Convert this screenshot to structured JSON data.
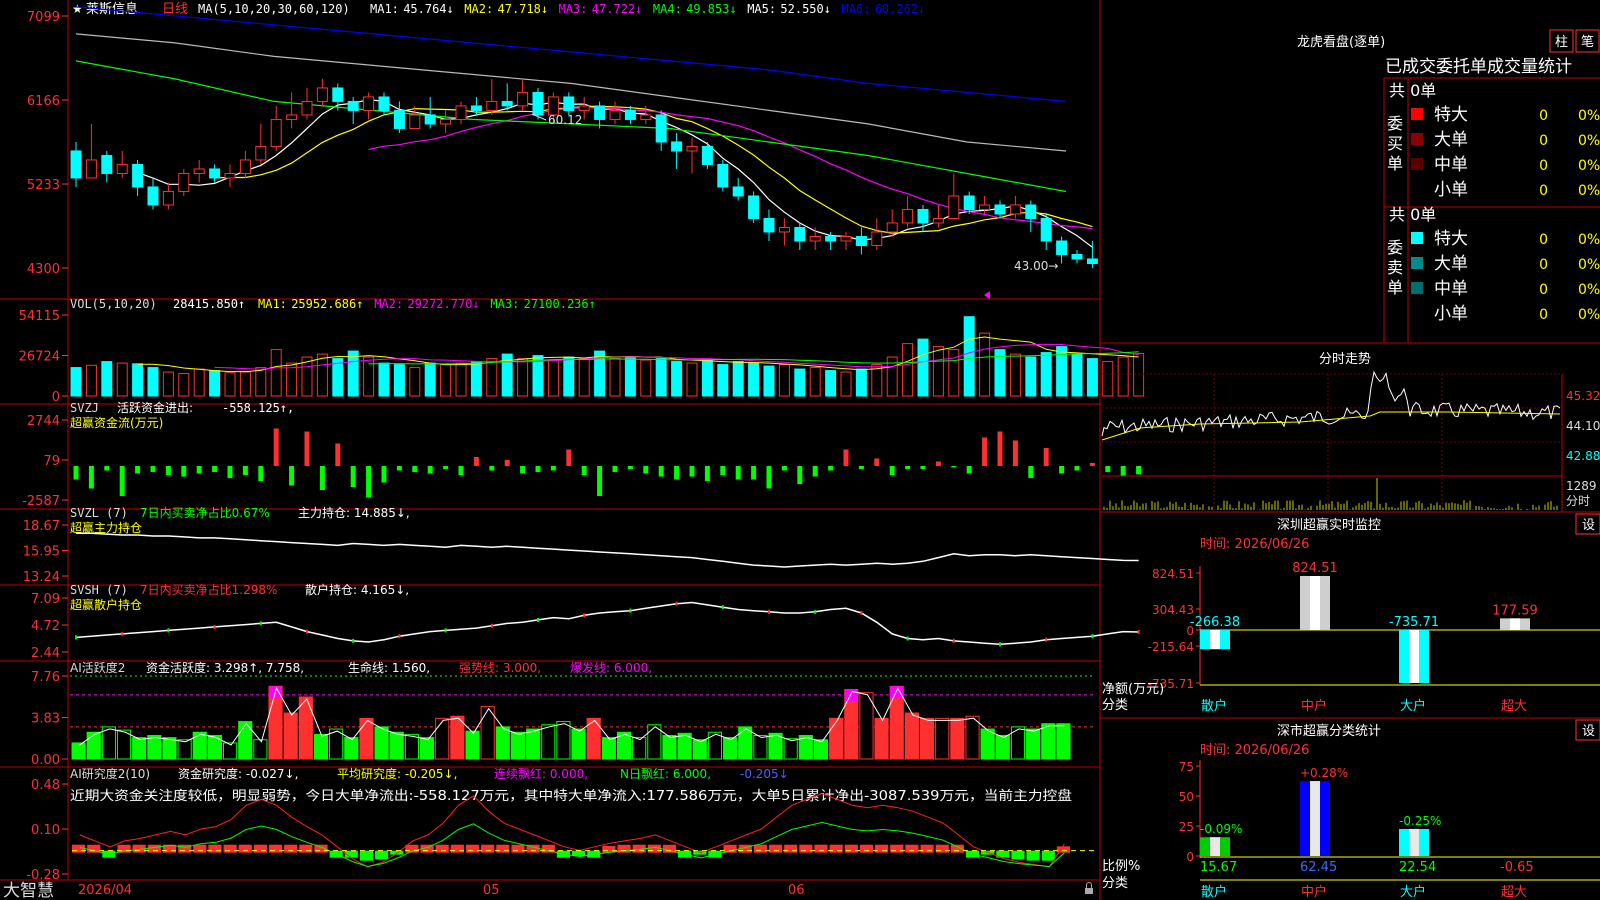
{
  "stock": {
    "name": "莱斯信息",
    "period": "日线",
    "star": "★",
    "ma_params": "MA(5,10,20,30,60,120)"
  },
  "ma_readouts": [
    {
      "label": "MA1:",
      "value": "45.764↓",
      "color": "#ffffff"
    },
    {
      "label": "MA2:",
      "value": "47.718↓",
      "color": "#ffff00"
    },
    {
      "label": "MA3:",
      "value": "47.722↓",
      "color": "#ff00ff"
    },
    {
      "label": "MA4:",
      "value": "49.853↓",
      "color": "#00ff00"
    },
    {
      "label": "MA5:",
      "value": "52.550↓",
      "color": "#ffffff"
    },
    {
      "label": "MA6:",
      "value": "60.262↓",
      "color": "#0000ff"
    }
  ],
  "price_axis": [
    "7099",
    "6166",
    "5233",
    "4300"
  ],
  "price_annotations": {
    "high": "60.12",
    "low": "43.00→"
  },
  "vol_panel": {
    "title": "VOL(5,10,20)",
    "value": "28415.850↑",
    "readouts": [
      {
        "label": "MA1:",
        "value": "25952.686↑",
        "color": "#ffff00"
      },
      {
        "label": "MA2:",
        "value": "29272.770↓",
        "color": "#ff00ff"
      },
      {
        "label": "MA3:",
        "value": "27100.236↑",
        "color": "#00ff00"
      }
    ],
    "axis": [
      "54115",
      "26724",
      "0"
    ]
  },
  "svzj_panel": {
    "title": "SVZJ",
    "label": "活跃资金进出:",
    "value": "-558.125↑,",
    "sub": "超赢资金流(万元)",
    "axis": [
      "2744",
      "79",
      "-2587"
    ]
  },
  "svzl_panel": {
    "title": "SVZL (7)",
    "label1": "7日内买卖净占比0.67%",
    "label2": "主力持仓: 14.885↓,",
    "sub": "超赢主力持仓",
    "axis": [
      "18.67",
      "15.95",
      "13.24"
    ]
  },
  "svsh_panel": {
    "title": "SVSH (7)",
    "label1": "7日内买卖净占比1.298%",
    "label2": "散户持仓: 4.165↓,",
    "sub": "超赢散户持仓",
    "axis": [
      "7.09",
      "4.72",
      "2.44"
    ]
  },
  "ai_active_panel": {
    "title": "AI活跃度2",
    "label1": "资金活跃度: 3.298↑, 7.758,",
    "label2": "生命线: 1.560,",
    "label3": "强势线: 3.000,",
    "label4": "爆发线: 6.000,",
    "axis": [
      "7.76",
      "3.83",
      "0.00"
    ]
  },
  "ai_research_panel": {
    "title": "AI研究度2(10)",
    "label1": "资金研究度: -0.027↓,",
    "label2": "平均研究度: -0.205↓,",
    "label3": "连续飘红: 0.000,",
    "label4": "N日飘红: 6.000,",
    "label5": "-0.205↓",
    "commentary": "近期大资金关注度较低，明显弱势，今日大单净流出:-558.127万元，其中特大单净流入:177.586万元，大单5日累计净出-3087.539万元，当前主力控盘",
    "axis": [
      "0.48",
      "0.10",
      "-0.28"
    ]
  },
  "x_axis": {
    "start": "2026/04",
    "m1": "05",
    "m2": "06"
  },
  "brand": "大智慧",
  "right": {
    "title": "龙虎看盘(逐单)",
    "btn_zhu": "柱",
    "btn_bi": "笔",
    "tab": "已成交委托单成交量统计",
    "buy": {
      "side": "委买单",
      "total": "共 0单",
      "rows": [
        {
          "name": "特大",
          "count": "0",
          "pct": "0%",
          "color": "#ff0000"
        },
        {
          "name": "大单",
          "count": "0",
          "pct": "0%",
          "color": "#8b0000"
        },
        {
          "name": "中单",
          "count": "0",
          "pct": "0%",
          "color": "#5a0000"
        },
        {
          "name": "小单",
          "count": "0",
          "pct": "0%",
          "color": ""
        }
      ]
    },
    "sell": {
      "side": "委卖单",
      "total": "共 0单",
      "rows": [
        {
          "name": "特大",
          "count": "0",
          "pct": "0%",
          "color": "#00ffff"
        },
        {
          "name": "大单",
          "count": "0",
          "pct": "0%",
          "color": "#008b8b"
        },
        {
          "name": "中单",
          "count": "0",
          "pct": "0%",
          "color": "#006e6e"
        },
        {
          "name": "小单",
          "count": "0",
          "pct": "0%",
          "color": ""
        }
      ]
    },
    "intraday": {
      "title": "分时走势",
      "axis": [
        "45.32",
        "44.10",
        "42.88"
      ],
      "vol_label": "1289",
      "vol_sub": "分时"
    },
    "monitor": {
      "title": "深圳超赢实时监控",
      "set": "设",
      "time": "时间: 2026/06/26",
      "axis": [
        "824.51",
        "304.43",
        "0",
        "-215.64",
        "-735.71"
      ],
      "y_label": "净额(万元)",
      "x_label": "分类",
      "categories": [
        "散户",
        "中户",
        "大户",
        "超大"
      ],
      "values": [
        -266.38,
        824.51,
        -735.71,
        177.59
      ],
      "value_labels": [
        "-266.38",
        "824.51",
        "-735.71",
        "177.59"
      ]
    },
    "classify": {
      "title": "深市超赢分类统计",
      "set": "设",
      "time": "时间: 2026/06/26",
      "axis": [
        "75",
        "50",
        "25",
        "0"
      ],
      "y_label": "比例%",
      "x_label": "分类",
      "categories": [
        "散户",
        "中户",
        "大户",
        "超大"
      ],
      "values": [
        15.67,
        62.45,
        22.54,
        -0.65
      ],
      "value_labels": [
        "15.67",
        "62.45",
        "22.54",
        "-0.65"
      ],
      "change_labels": [
        "-0.09%",
        "+0.28%",
        "-0.25%",
        ""
      ]
    }
  },
  "chart_data": [
    {
      "type": "candlestick",
      "title": "莱斯信息 日线",
      "x": [
        "2026/04",
        "05",
        "06"
      ],
      "ylim": [
        43.0,
        60.12
      ],
      "candles": [
        {
          "o": 5.6,
          "c": 5.3,
          "h": 5.7,
          "l": 5.2
        },
        {
          "o": 5.3,
          "c": 5.5,
          "h": 5.9,
          "l": 5.3
        },
        {
          "o": 5.55,
          "c": 5.35,
          "h": 5.6,
          "l": 5.25
        },
        {
          "o": 5.35,
          "c": 5.45,
          "h": 5.6,
          "l": 5.3
        },
        {
          "o": 5.45,
          "c": 5.2,
          "h": 5.5,
          "l": 5.1
        },
        {
          "o": 5.2,
          "c": 5.0,
          "h": 5.3,
          "l": 4.95
        },
        {
          "o": 5.0,
          "c": 5.15,
          "h": 5.25,
          "l": 4.95
        },
        {
          "o": 5.15,
          "c": 5.35,
          "h": 5.4,
          "l": 5.1
        },
        {
          "o": 5.35,
          "c": 5.4,
          "h": 5.5,
          "l": 5.25
        },
        {
          "o": 5.4,
          "c": 5.3,
          "h": 5.45,
          "l": 5.25
        },
        {
          "o": 5.3,
          "c": 5.35,
          "h": 5.45,
          "l": 5.2
        },
        {
          "o": 5.35,
          "c": 5.5,
          "h": 5.6,
          "l": 5.3
        },
        {
          "o": 5.5,
          "c": 5.65,
          "h": 5.9,
          "l": 5.45
        },
        {
          "o": 5.65,
          "c": 5.95,
          "h": 6.1,
          "l": 5.6
        },
        {
          "o": 5.95,
          "c": 6.0,
          "h": 6.25,
          "l": 5.85
        },
        {
          "o": 6.0,
          "c": 6.15,
          "h": 6.3,
          "l": 5.95
        },
        {
          "o": 6.15,
          "c": 6.3,
          "h": 6.4,
          "l": 6.1
        },
        {
          "o": 6.3,
          "c": 6.15,
          "h": 6.35,
          "l": 6.05
        },
        {
          "o": 6.15,
          "c": 6.05,
          "h": 6.2,
          "l": 5.9
        },
        {
          "o": 6.05,
          "c": 6.2,
          "h": 6.25,
          "l": 5.95
        },
        {
          "o": 6.2,
          "c": 6.05,
          "h": 6.25,
          "l": 6.0
        },
        {
          "o": 6.05,
          "c": 5.85,
          "h": 6.15,
          "l": 5.8
        },
        {
          "o": 5.85,
          "c": 6.0,
          "h": 6.1,
          "l": 5.85
        },
        {
          "o": 6.0,
          "c": 5.9,
          "h": 6.2,
          "l": 5.85
        },
        {
          "o": 5.9,
          "c": 5.95,
          "h": 6.05,
          "l": 5.8
        },
        {
          "o": 5.95,
          "c": 6.1,
          "h": 6.15,
          "l": 5.9
        },
        {
          "o": 6.1,
          "c": 6.05,
          "h": 6.2,
          "l": 6.0
        },
        {
          "o": 6.05,
          "c": 6.15,
          "h": 6.4,
          "l": 6.0
        },
        {
          "o": 6.15,
          "c": 6.1,
          "h": 6.35,
          "l": 6.05
        },
        {
          "o": 6.1,
          "c": 6.25,
          "h": 6.4,
          "l": 6.05
        },
        {
          "o": 6.25,
          "c": 6.0,
          "h": 6.3,
          "l": 5.95
        },
        {
          "o": 6.0,
          "c": 6.2,
          "h": 6.25,
          "l": 5.9
        },
        {
          "o": 6.2,
          "c": 6.05,
          "h": 6.25,
          "l": 6.0
        },
        {
          "o": 6.05,
          "c": 6.1,
          "h": 6.2,
          "l": 5.95
        },
        {
          "o": 6.1,
          "c": 5.95,
          "h": 6.15,
          "l": 5.85
        },
        {
          "o": 5.95,
          "c": 6.05,
          "h": 6.15,
          "l": 5.9
        },
        {
          "o": 6.05,
          "c": 5.95,
          "h": 6.1,
          "l": 5.9
        },
        {
          "o": 5.95,
          "c": 6.0,
          "h": 6.1,
          "l": 5.9
        },
        {
          "o": 6.0,
          "c": 5.7,
          "h": 6.05,
          "l": 5.6
        },
        {
          "o": 5.7,
          "c": 5.6,
          "h": 5.8,
          "l": 5.4
        },
        {
          "o": 5.6,
          "c": 5.65,
          "h": 5.75,
          "l": 5.35
        },
        {
          "o": 5.65,
          "c": 5.45,
          "h": 5.7,
          "l": 5.4
        },
        {
          "o": 5.45,
          "c": 5.2,
          "h": 5.5,
          "l": 5.15
        },
        {
          "o": 5.2,
          "c": 5.1,
          "h": 5.3,
          "l": 5.05
        },
        {
          "o": 5.1,
          "c": 4.85,
          "h": 5.15,
          "l": 4.8
        },
        {
          "o": 4.85,
          "c": 4.7,
          "h": 4.95,
          "l": 4.6
        },
        {
          "o": 4.7,
          "c": 4.75,
          "h": 4.85,
          "l": 4.55
        },
        {
          "o": 4.75,
          "c": 4.6,
          "h": 4.8,
          "l": 4.5
        },
        {
          "o": 4.6,
          "c": 4.65,
          "h": 4.75,
          "l": 4.5
        },
        {
          "o": 4.65,
          "c": 4.6,
          "h": 4.7,
          "l": 4.5
        },
        {
          "o": 4.6,
          "c": 4.65,
          "h": 4.7,
          "l": 4.5
        },
        {
          "o": 4.65,
          "c": 4.55,
          "h": 4.75,
          "l": 4.45
        },
        {
          "o": 4.55,
          "c": 4.7,
          "h": 4.85,
          "l": 4.5
        },
        {
          "o": 4.7,
          "c": 4.8,
          "h": 4.95,
          "l": 4.65
        },
        {
          "o": 4.8,
          "c": 4.95,
          "h": 5.1,
          "l": 4.75
        },
        {
          "o": 4.95,
          "c": 4.8,
          "h": 5.0,
          "l": 4.7
        },
        {
          "o": 4.8,
          "c": 4.85,
          "h": 5.0,
          "l": 4.75
        },
        {
          "o": 4.85,
          "c": 5.1,
          "h": 5.35,
          "l": 4.85
        },
        {
          "o": 5.1,
          "c": 4.95,
          "h": 5.15,
          "l": 4.9
        },
        {
          "o": 4.95,
          "c": 5.0,
          "h": 5.1,
          "l": 4.9
        },
        {
          "o": 5.0,
          "c": 4.9,
          "h": 5.05,
          "l": 4.85
        },
        {
          "o": 4.9,
          "c": 5.0,
          "h": 5.1,
          "l": 4.85
        },
        {
          "o": 5.0,
          "c": 4.85,
          "h": 5.05,
          "l": 4.7
        },
        {
          "o": 4.85,
          "c": 4.6,
          "h": 4.9,
          "l": 4.5
        },
        {
          "o": 4.6,
          "c": 4.45,
          "h": 4.65,
          "l": 4.35
        },
        {
          "o": 4.45,
          "c": 4.4,
          "h": 4.5,
          "l": 4.35
        },
        {
          "o": 4.4,
          "c": 4.35,
          "h": 4.6,
          "l": 4.3
        }
      ]
    },
    {
      "type": "bar",
      "title": "VOL(5,10,20)",
      "ylim": [
        0,
        54115
      ],
      "values": [
        19000,
        20500,
        23000,
        22000,
        21500,
        19000,
        16000,
        15000,
        18000,
        17000,
        15500,
        16000,
        19000,
        31000,
        22000,
        26000,
        28000,
        25000,
        30000,
        26000,
        22000,
        21000,
        19000,
        22000,
        21000,
        22000,
        23000,
        25000,
        28000,
        25000,
        27000,
        24000,
        26000,
        25000,
        30000,
        25000,
        26000,
        24000,
        25000,
        23000,
        22000,
        24000,
        21000,
        23000,
        22000,
        20000,
        21000,
        18000,
        19000,
        17000,
        16000,
        18000,
        21000,
        26000,
        35000,
        38000,
        33000,
        31000,
        53000,
        42000,
        31000,
        28000,
        26000,
        29000,
        33000,
        28000,
        25000,
        23000,
        26000,
        28415
      ]
    },
    {
      "type": "bar",
      "title": "SVZJ 活跃资金进出",
      "ylim": [
        -2587,
        2744
      ],
      "values": [
        -900,
        -1500,
        -300,
        -2000,
        -500,
        -400,
        -600,
        -700,
        -500,
        -400,
        -800,
        -600,
        -1000,
        2500,
        -1300,
        2300,
        -1600,
        1500,
        -1400,
        -2100,
        -1100,
        -300,
        -400,
        -500,
        -200,
        -600,
        600,
        -300,
        400,
        -500,
        -400,
        -300,
        1100,
        -600,
        -2000,
        -400,
        -200,
        -500,
        -700,
        -900,
        -700,
        -1000,
        -600,
        -900,
        -900,
        -1500,
        -300,
        -1200,
        -700,
        -300,
        1100,
        -200,
        500,
        -600,
        -200,
        -200,
        300,
        -100,
        -500,
        1900,
        2300,
        1700,
        -800,
        1200,
        -500,
        -300,
        200,
        -400,
        -700,
        -558
      ]
    },
    {
      "type": "line",
      "title": "SVZL 主力持仓",
      "ylim": [
        13.24,
        18.67
      ],
      "values": [
        17.8,
        17.8,
        17.7,
        17.6,
        17.6,
        17.5,
        17.5,
        17.4,
        17.3,
        17.3,
        17.2,
        17.1,
        17.0,
        16.9,
        16.8,
        16.7,
        16.6,
        16.5,
        16.7,
        16.6,
        16.5,
        16.6,
        16.5,
        16.4,
        16.3,
        16.5,
        16.4,
        16.3,
        16.4,
        16.3,
        16.2,
        16.1,
        16.0,
        15.9,
        15.8,
        15.7,
        15.6,
        15.5,
        15.4,
        15.3,
        15.2,
        15.0,
        14.8,
        14.6,
        14.4,
        14.3,
        14.2,
        14.3,
        14.4,
        14.5,
        14.4,
        14.5,
        14.6,
        14.5,
        14.6,
        14.8,
        15.2,
        15.6,
        15.4,
        15.5,
        15.5,
        15.4,
        15.5,
        15.4,
        15.3,
        15.2,
        15.1,
        15.0,
        14.9,
        14.885
      ]
    },
    {
      "type": "line",
      "title": "SVSH 散户持仓",
      "ylim": [
        2.44,
        7.09
      ],
      "values": [
        3.7,
        3.8,
        3.9,
        4.0,
        4.1,
        4.2,
        4.3,
        4.4,
        4.5,
        4.6,
        4.7,
        4.8,
        4.9,
        5.0,
        4.6,
        4.2,
        3.9,
        3.6,
        3.4,
        3.3,
        3.5,
        3.8,
        4.0,
        4.2,
        4.3,
        4.4,
        4.5,
        4.7,
        4.9,
        5.0,
        5.2,
        5.4,
        5.3,
        5.6,
        5.8,
        5.9,
        6.0,
        6.2,
        6.4,
        6.6,
        6.7,
        6.5,
        6.3,
        6.1,
        6.0,
        5.9,
        5.8,
        5.8,
        5.9,
        6.1,
        6.2,
        5.8,
        5.0,
        4.0,
        3.6,
        3.5,
        3.6,
        3.4,
        3.3,
        3.2,
        3.1,
        3.2,
        3.3,
        3.5,
        3.6,
        3.7,
        3.8,
        4.0,
        4.2,
        4.165
      ]
    },
    {
      "type": "bar",
      "title": "AI活跃度2 资金活跃度",
      "ylim": [
        0.0,
        7.76
      ],
      "values": [
        1.5,
        2.5,
        3.0,
        2.7,
        2.0,
        2.2,
        2.0,
        1.8,
        2.5,
        2.2,
        1.5,
        3.5,
        1.8,
        6.8,
        4.3,
        5.8,
        2.3,
        2.8,
        2.0,
        3.8,
        3.0,
        2.5,
        2.3,
        2.0,
        3.8,
        4.0,
        2.6,
        4.9,
        3.0,
        2.5,
        2.8,
        3.2,
        3.5,
        2.8,
        3.8,
        2.0,
        2.5,
        2.0,
        3.2,
        2.2,
        2.4,
        1.8,
        2.5,
        2.0,
        3.0,
        2.2,
        2.4,
        1.9,
        2.2,
        1.8,
        3.8,
        6.5,
        6.2,
        3.8,
        6.8,
        4.3,
        3.8,
        3.8,
        3.8,
        4.0,
        2.8,
        2.2,
        3.0,
        2.8,
        3.3,
        3.298
      ]
    },
    {
      "type": "line",
      "title": "AI研究度2(10)",
      "ylim": [
        -0.28,
        0.48
      ],
      "values": [
        0.05,
        0.0,
        -0.05,
        0.0,
        0.02,
        0.05,
        0.08,
        0.05,
        0.1,
        0.12,
        0.18,
        0.3,
        0.35,
        0.3,
        0.2,
        0.12,
        0.05,
        -0.05,
        -0.15,
        -0.22,
        -0.18,
        -0.1,
        0.0,
        0.05,
        0.15,
        0.3,
        0.38,
        0.25,
        0.15,
        0.1,
        0.05,
        0.0,
        -0.05,
        -0.08,
        -0.05,
        -0.02,
        0.0,
        0.02,
        0.05,
        0.0,
        -0.05,
        -0.1,
        -0.05,
        0.0,
        0.05,
        0.1,
        0.2,
        0.3,
        0.35,
        0.4,
        0.35,
        0.3,
        0.28,
        0.3,
        0.28,
        0.25,
        0.2,
        0.15,
        0.05,
        -0.05,
        -0.1,
        -0.15,
        -0.18,
        -0.2,
        -0.22,
        -0.027
      ]
    },
    {
      "type": "bar",
      "title": "深圳超赢实时监控",
      "categories": [
        "散户",
        "中户",
        "大户",
        "超大"
      ],
      "values": [
        -266.38,
        824.51,
        -735.71,
        177.59
      ],
      "ylabel": "净额(万元)",
      "xlabel": "分类"
    },
    {
      "type": "bar",
      "title": "深市超赢分类统计",
      "categories": [
        "散户",
        "中户",
        "大户",
        "超大"
      ],
      "values": [
        15.67,
        62.45,
        22.54,
        -0.65
      ],
      "ylabel": "比例%",
      "xlabel": "分类",
      "ylim": [
        0,
        75
      ]
    }
  ]
}
